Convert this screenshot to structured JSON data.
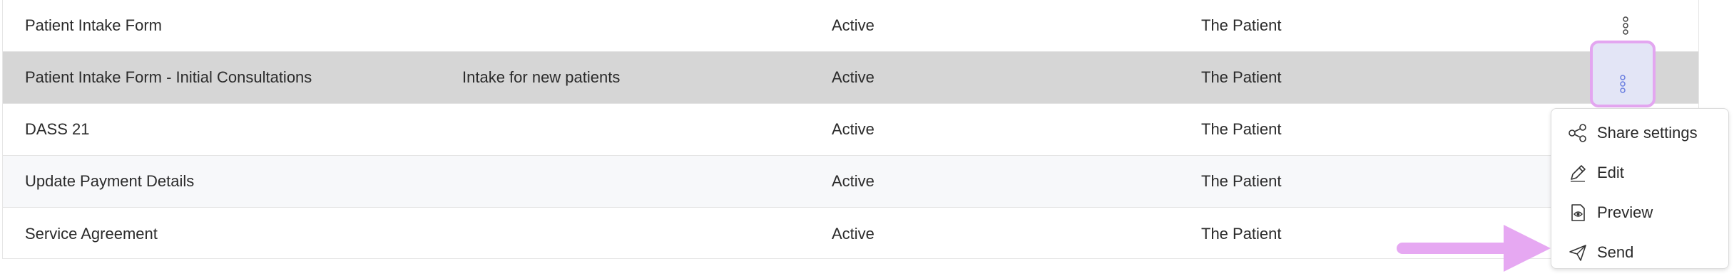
{
  "rows": [
    {
      "name": "Patient Intake Form",
      "description": "",
      "status": "Active",
      "recipient": "The Patient"
    },
    {
      "name": "Patient Intake Form - Initial Consultations",
      "description": "Intake for new patients",
      "status": "Active",
      "recipient": "The Patient"
    },
    {
      "name": "DASS 21",
      "description": "",
      "status": "Active",
      "recipient": "The Patient"
    },
    {
      "name": "Update Payment Details",
      "description": "",
      "status": "Active",
      "recipient": "The Patient"
    },
    {
      "name": "Service Agreement",
      "description": "",
      "status": "Active",
      "recipient": "The Patient"
    }
  ],
  "menu": {
    "items": [
      {
        "label": "Share settings",
        "icon": "share-icon"
      },
      {
        "label": "Edit",
        "icon": "pencil-icon"
      },
      {
        "label": "Preview",
        "icon": "preview-icon"
      },
      {
        "label": "Send",
        "icon": "send-icon"
      }
    ]
  },
  "colors": {
    "selected_row": "#d6d6d6",
    "highlight_border": "#e3a6f0",
    "arrow": "#e6a8f2",
    "kebab_active": "#6b7fe0"
  }
}
